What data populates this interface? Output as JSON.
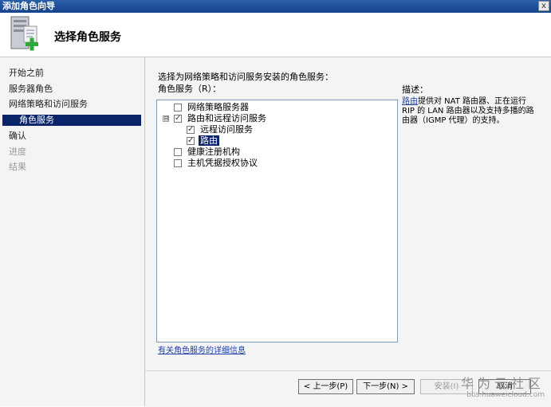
{
  "window": {
    "title": "添加角色向导",
    "close_glyph": "x"
  },
  "header": {
    "title": "选择角色服务",
    "icon": "server-role-add-icon"
  },
  "nav": {
    "items": [
      {
        "label": "开始之前",
        "state": "normal"
      },
      {
        "label": "服务器角色",
        "state": "normal"
      },
      {
        "label": "网络策略和访问服务",
        "state": "normal"
      },
      {
        "label": "角色服务",
        "state": "selected"
      },
      {
        "label": "确认",
        "state": "normal"
      },
      {
        "label": "进度",
        "state": "disabled"
      },
      {
        "label": "结果",
        "state": "disabled"
      }
    ]
  },
  "main": {
    "instruction": "选择为网络策略和访问服务安装的角色服务：",
    "list_label": "角色服务（R）：",
    "tree": [
      {
        "label": "网络策略服务器",
        "checked": false
      },
      {
        "label": "路由和远程访问服务",
        "checked": true,
        "expander": "⊟"
      },
      {
        "label": "远程访问服务",
        "checked": true
      },
      {
        "label": "路由",
        "checked": true,
        "selected": true
      },
      {
        "label": "健康注册机构",
        "checked": false
      },
      {
        "label": "主机凭据授权协议",
        "checked": false
      }
    ],
    "check_glyph": "✓",
    "description": {
      "title": "描述：",
      "link": "路由",
      "text": "提供对 NAT 路由器、正在运行 RIP 的 LAN 路由器以及支持多播的路由器（IGMP 代理）的支持。"
    },
    "more_link": "有关角色服务的详细信息"
  },
  "footer": {
    "back": "< 上一步(P)",
    "next": "下一步(N) >",
    "install": "安装(I)",
    "cancel": "取消"
  },
  "watermark": {
    "text": "华为云社区",
    "url": "bbs.huaweicloud.com"
  }
}
